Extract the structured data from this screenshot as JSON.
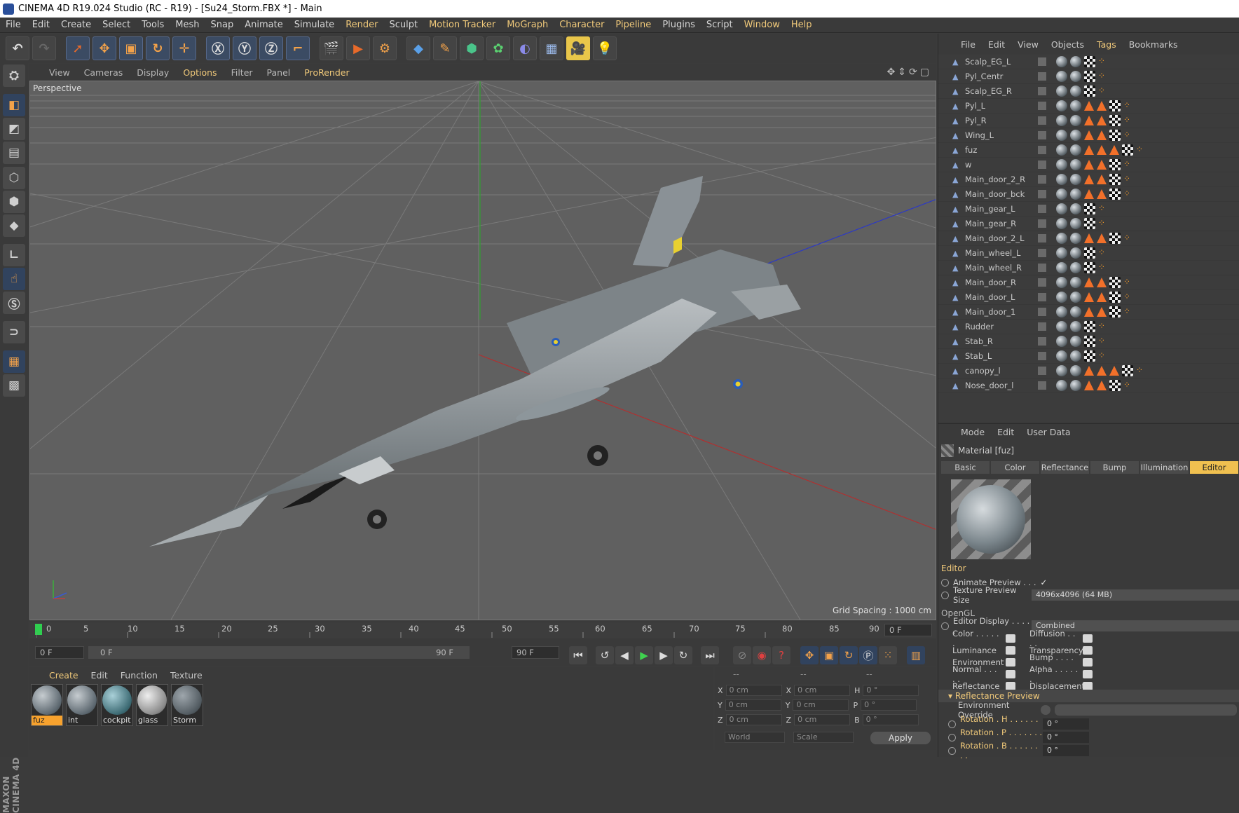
{
  "window": {
    "title": "CINEMA 4D R19.024 Studio (RC - R19) - [Su24_Storm.FBX *] - Main"
  },
  "menu": [
    "File",
    "Edit",
    "Create",
    "Select",
    "Tools",
    "Mesh",
    "Snap",
    "Animate",
    "Simulate",
    "Render",
    "Sculpt",
    "Motion Tracker",
    "MoGraph",
    "Character",
    "Pipeline",
    "Plugins",
    "Script",
    "Window",
    "Help"
  ],
  "viewport": {
    "menu": [
      "View",
      "Cameras",
      "Display",
      "Options",
      "Filter",
      "Panel",
      "ProRender"
    ],
    "label": "Perspective",
    "grid_spacing": "Grid Spacing : 1000 cm"
  },
  "timeline": {
    "ticks": [
      "0",
      "5",
      "10",
      "15",
      "20",
      "25",
      "30",
      "35",
      "40",
      "45",
      "50",
      "55",
      "60",
      "65",
      "70",
      "75",
      "80",
      "85",
      "90"
    ],
    "frame_field": "0 F",
    "start": "0 F",
    "range_start": "0 F",
    "range_end": "90 F",
    "end": "90 F"
  },
  "materials": {
    "menu": [
      "Create",
      "Edit",
      "Function",
      "Texture"
    ],
    "items": [
      "fuz",
      "int",
      "cockpit",
      "glass",
      "Storm"
    ]
  },
  "coords": {
    "headers": [
      "--",
      "--",
      "--"
    ],
    "rows": [
      {
        "a": "X",
        "av": "0 cm",
        "b": "X",
        "bv": "0 cm",
        "c": "H",
        "cv": "0 °"
      },
      {
        "a": "Y",
        "av": "0 cm",
        "b": "Y",
        "bv": "0 cm",
        "c": "P",
        "cv": "0 °"
      },
      {
        "a": "Z",
        "av": "0 cm",
        "b": "Z",
        "bv": "0 cm",
        "c": "B",
        "cv": "0 °"
      }
    ],
    "space": "World",
    "mode": "Scale",
    "apply": "Apply"
  },
  "objects": {
    "menu": [
      "File",
      "Edit",
      "View",
      "Objects",
      "Tags",
      "Bookmarks"
    ],
    "rows": [
      {
        "name": "Scalp_EG_L",
        "tris": 0
      },
      {
        "name": "Pyl_Centr",
        "tris": 0
      },
      {
        "name": "Scalp_EG_R",
        "tris": 0
      },
      {
        "name": "Pyl_L",
        "tris": 2
      },
      {
        "name": "Pyl_R",
        "tris": 2
      },
      {
        "name": "Wing_L",
        "tris": 2
      },
      {
        "name": "fuz",
        "tris": 3
      },
      {
        "name": "w",
        "tris": 2
      },
      {
        "name": "Main_door_2_R",
        "tris": 2
      },
      {
        "name": "Main_door_bck",
        "tris": 2
      },
      {
        "name": "Main_gear_L",
        "tris": 0
      },
      {
        "name": "Main_gear_R",
        "tris": 0
      },
      {
        "name": "Main_door_2_L",
        "tris": 2
      },
      {
        "name": "Main_wheel_L",
        "tris": 0
      },
      {
        "name": "Main_wheel_R",
        "tris": 0
      },
      {
        "name": "Main_door_R",
        "tris": 2
      },
      {
        "name": "Main_door_L",
        "tris": 2
      },
      {
        "name": "Main_door_1",
        "tris": 2
      },
      {
        "name": "Rudder",
        "tris": 0
      },
      {
        "name": "Stab_R",
        "tris": 0
      },
      {
        "name": "Stab_L",
        "tris": 0
      },
      {
        "name": "canopy_l",
        "tris": 3
      },
      {
        "name": "Nose_door_l",
        "tris": 2
      }
    ]
  },
  "attributes": {
    "menu": [
      "Mode",
      "Edit",
      "User Data"
    ],
    "title": "Material [fuz]",
    "tabs": [
      "Basic",
      "Color",
      "Reflectance",
      "Bump",
      "Illumination",
      "Editor"
    ],
    "editor_header": "Editor",
    "animate_preview": "Animate Preview . . .",
    "animate_check": "✓",
    "texture_preview_label": "Texture Preview Size",
    "texture_preview_value": "4096x4096 (64 MB)",
    "opengl": "OpenGL",
    "editor_display_label": "Editor Display . . . . .",
    "editor_display_value": "Combined",
    "channels_left": [
      "Color . . . . . .",
      "Luminance",
      "Environment",
      "Normal . . . . .",
      "Reflectance"
    ],
    "channels_right": [
      "Diffusion . . . .",
      "Transparency",
      "Bump . . . . . . .",
      "Alpha . . . . . .",
      "Displacement"
    ],
    "refl_preview": "Reflectance Preview",
    "env_override": "Environment Override",
    "rotations": [
      {
        "label": "Rotation . H . . . . . . . .",
        "value": "0 °"
      },
      {
        "label": "Rotation . P . . . . . . . .",
        "value": "0 °"
      },
      {
        "label": "Rotation . B . . . . . . . .",
        "value": "0 °"
      }
    ]
  },
  "branding": "MAXON CINEMA 4D",
  "colors": {
    "accent": "#f0c97a",
    "active_tab": "#f0c050",
    "selected_material": "#f7a22e",
    "viewport_bg": "#606060",
    "panel_bg": "#3a3a3a"
  }
}
